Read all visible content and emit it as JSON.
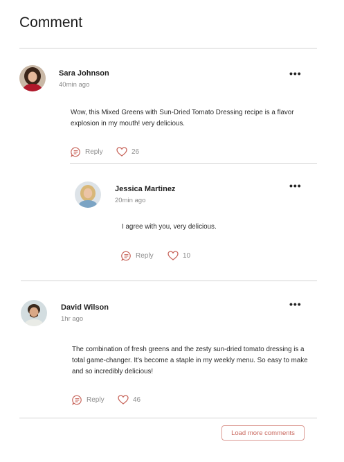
{
  "header": {
    "title": "Comment"
  },
  "comments": [
    {
      "author": "Sara Johnson",
      "time": "40min ago",
      "text": "Wow, this Mixed Greens with Sun-Dried Tomato Dressing recipe is a flavor explosion in my mouth! very delicious.",
      "reply_label": "Reply",
      "likes": "26",
      "more_label": "•••",
      "replies": [
        {
          "author": "Jessica Martinez",
          "time": "20min ago",
          "text": "I agree with you, very delicious.",
          "reply_label": "Reply",
          "likes": "10",
          "more_label": "•••"
        }
      ]
    },
    {
      "author": "David Wilson",
      "time": "1hr ago",
      "text": "The combination of fresh greens and the zesty sun-dried tomato dressing is a total game-changer. It's become a staple in my weekly menu. So easy to make and so incredibly delicious!",
      "reply_label": "Reply",
      "likes": "46",
      "more_label": "•••"
    }
  ],
  "footer": {
    "load_more_label": "Load more comments"
  },
  "colors": {
    "accent": "#c8665c",
    "divider": "#d2d2d2",
    "muted": "#8d8d8d"
  },
  "icons": {
    "reply": "reply-bubble-icon",
    "like": "heart-icon",
    "more": "more-dots-icon"
  }
}
